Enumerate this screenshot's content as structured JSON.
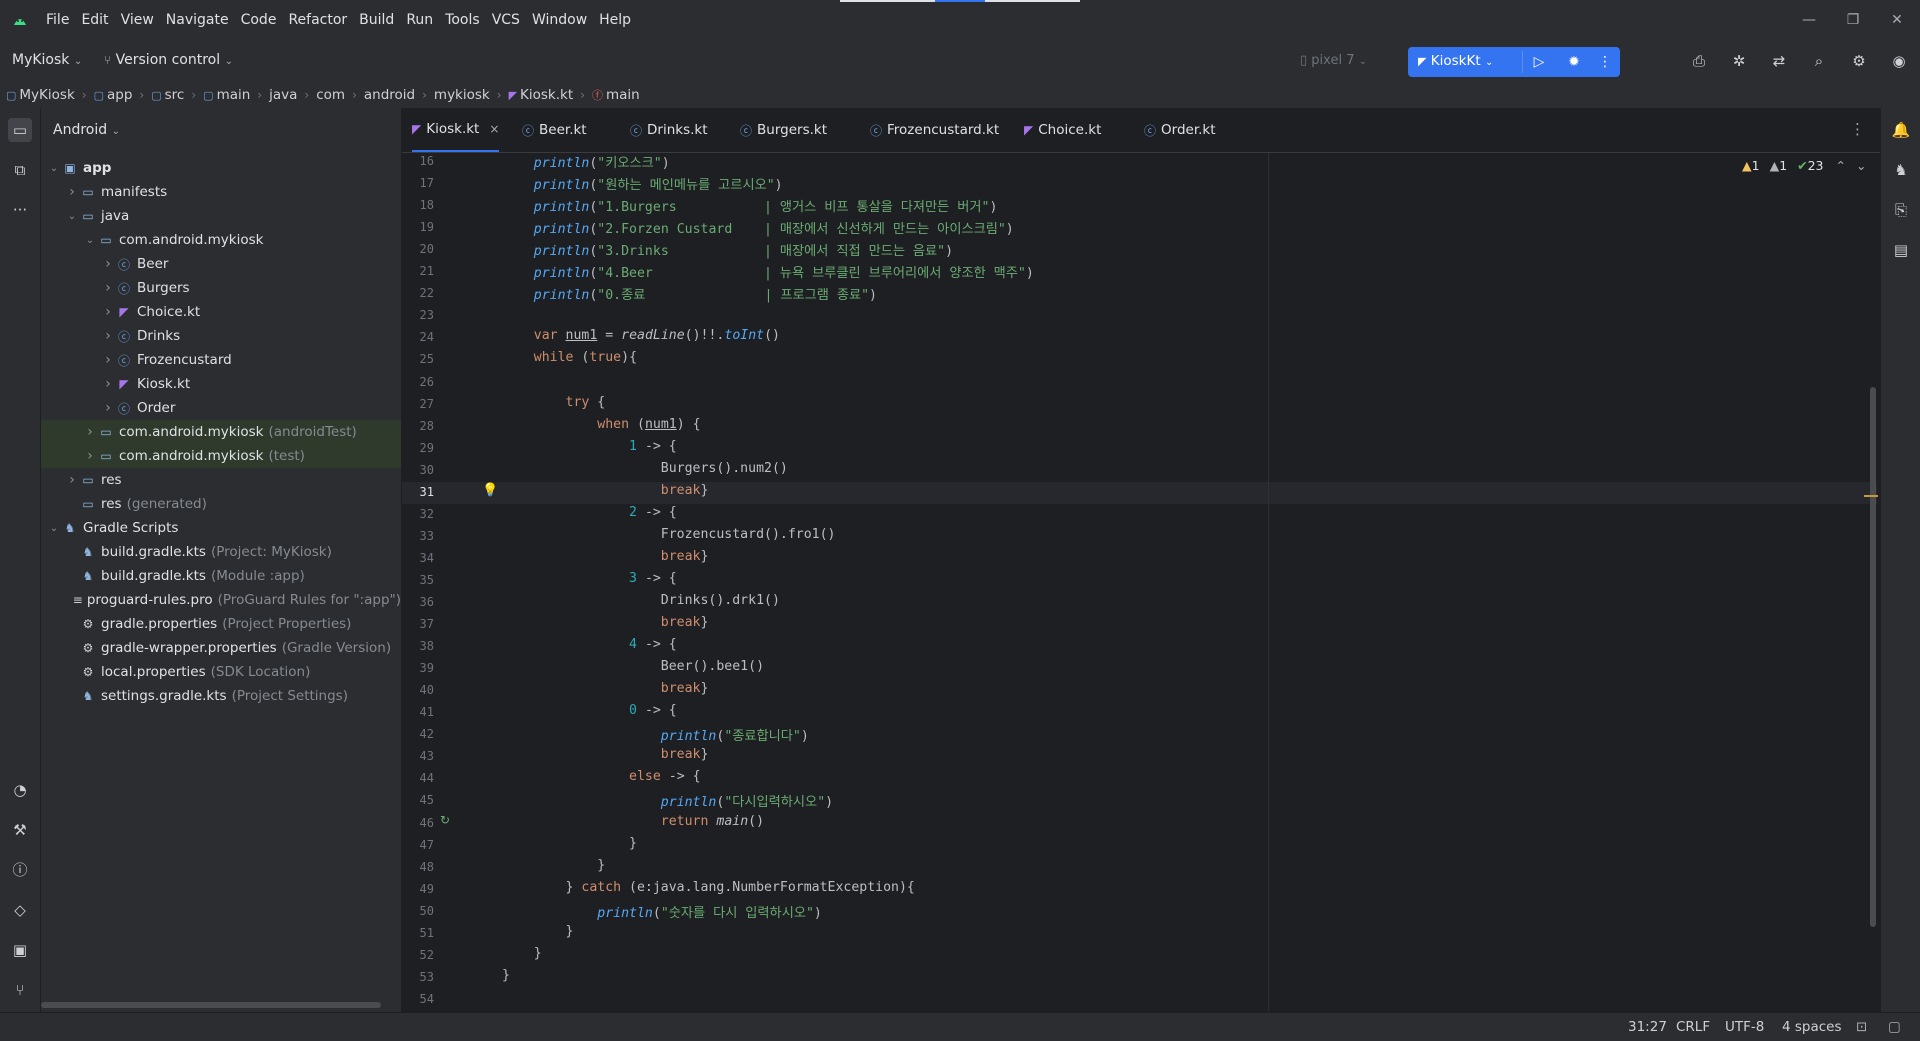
{
  "menu": [
    "File",
    "Edit",
    "View",
    "Navigate",
    "Code",
    "Refactor",
    "Build",
    "Run",
    "Tools",
    "VCS",
    "Window",
    "Help"
  ],
  "toolbar": {
    "project": "MyKiosk",
    "vcs": "Version control",
    "device": "pixel 7",
    "run_config": "KioskKt"
  },
  "breadcrumb": [
    "MyKiosk",
    "app",
    "src",
    "main",
    "java",
    "com",
    "android",
    "mykiosk",
    "Kiosk.kt",
    "main"
  ],
  "panel": {
    "title": "Android"
  },
  "tree": [
    {
      "label": "app",
      "hint": "",
      "icon": "folder-module",
      "depth": 0,
      "arrow": "open",
      "hl": false,
      "bold": true
    },
    {
      "label": "manifests",
      "hint": "",
      "icon": "folder",
      "depth": 1,
      "arrow": "closed",
      "hl": false
    },
    {
      "label": "java",
      "hint": "",
      "icon": "folder",
      "depth": 1,
      "arrow": "open",
      "hl": false
    },
    {
      "label": "com.android.mykiosk",
      "hint": "",
      "icon": "package",
      "depth": 2,
      "arrow": "open",
      "hl": false
    },
    {
      "label": "Beer",
      "hint": "",
      "icon": "class",
      "depth": 3,
      "arrow": "closed",
      "hl": false
    },
    {
      "label": "Burgers",
      "hint": "",
      "icon": "class",
      "depth": 3,
      "arrow": "closed",
      "hl": false
    },
    {
      "label": "Choice.kt",
      "hint": "",
      "icon": "kotlin",
      "depth": 3,
      "arrow": "closed",
      "hl": false
    },
    {
      "label": "Drinks",
      "hint": "",
      "icon": "class",
      "depth": 3,
      "arrow": "closed",
      "hl": false
    },
    {
      "label": "Frozencustard",
      "hint": "",
      "icon": "class",
      "depth": 3,
      "arrow": "closed",
      "hl": false
    },
    {
      "label": "Kiosk.kt",
      "hint": "",
      "icon": "kotlin",
      "depth": 3,
      "arrow": "closed",
      "hl": false
    },
    {
      "label": "Order",
      "hint": "",
      "icon": "class",
      "depth": 3,
      "arrow": "closed",
      "hl": false
    },
    {
      "label": "com.android.mykiosk",
      "hint": "(androidTest)",
      "icon": "package",
      "depth": 2,
      "arrow": "closed",
      "hl": true
    },
    {
      "label": "com.android.mykiosk",
      "hint": "(test)",
      "icon": "package",
      "depth": 2,
      "arrow": "closed",
      "hl": true
    },
    {
      "label": "res",
      "hint": "",
      "icon": "folder",
      "depth": 1,
      "arrow": "closed",
      "hl": false
    },
    {
      "label": "res",
      "hint": "(generated)",
      "icon": "folder",
      "depth": 1,
      "arrow": "none",
      "hl": false
    },
    {
      "label": "Gradle Scripts",
      "hint": "",
      "icon": "gradle",
      "depth": 0,
      "arrow": "open",
      "hl": false
    },
    {
      "label": "build.gradle.kts",
      "hint": "(Project: MyKiosk)",
      "icon": "gradle-file",
      "depth": 1,
      "arrow": "none",
      "hl": false
    },
    {
      "label": "build.gradle.kts",
      "hint": "(Module :app)",
      "icon": "gradle-file",
      "depth": 1,
      "arrow": "none",
      "hl": false
    },
    {
      "label": "proguard-rules.pro",
      "hint": "(ProGuard Rules for \":app\")",
      "icon": "text-file",
      "depth": 1,
      "arrow": "none",
      "hl": false
    },
    {
      "label": "gradle.properties",
      "hint": "(Project Properties)",
      "icon": "settings-file",
      "depth": 1,
      "arrow": "none",
      "hl": false
    },
    {
      "label": "gradle-wrapper.properties",
      "hint": "(Gradle Version)",
      "icon": "settings-file",
      "depth": 1,
      "arrow": "none",
      "hl": false
    },
    {
      "label": "local.properties",
      "hint": "(SDK Location)",
      "icon": "settings-file",
      "depth": 1,
      "arrow": "none",
      "hl": false
    },
    {
      "label": "settings.gradle.kts",
      "hint": "(Project Settings)",
      "icon": "gradle-file",
      "depth": 1,
      "arrow": "none",
      "hl": false
    }
  ],
  "tabs": [
    {
      "label": "Kiosk.kt",
      "active": true,
      "icon": "kotlin"
    },
    {
      "label": "Beer.kt",
      "active": false,
      "icon": "class"
    },
    {
      "label": "Drinks.kt",
      "active": false,
      "icon": "class"
    },
    {
      "label": "Burgers.kt",
      "active": false,
      "icon": "class"
    },
    {
      "label": "Frozencustard.kt",
      "active": false,
      "icon": "class"
    },
    {
      "label": "Choice.kt",
      "active": false,
      "icon": "kotlin"
    },
    {
      "label": "Order.kt",
      "active": false,
      "icon": "class"
    }
  ],
  "inspections": {
    "warnings": "1",
    "weak": "1",
    "ok": "23"
  },
  "code": {
    "first_line": 16,
    "current_line": 31,
    "lines": [
      "    println(\"키오스크\")",
      "    println(\"원하는 메인메뉴를 고르시오\")",
      "    println(\"1.Burgers           | 앵거스 비프 통살을 다져만든 버거\")",
      "    println(\"2.Forzen Custard    | 매장에서 신선하게 만드는 아이스크림\")",
      "    println(\"3.Drinks            | 매장에서 직접 만드는 음료\")",
      "    println(\"4.Beer              | 뉴욕 브루클린 브루어리에서 양조한 맥주\")",
      "    println(\"0.종료               | 프로그램 종료\")",
      "",
      "    var num1 = readLine()!!.toInt()",
      "    while (true){",
      "",
      "        try {",
      "            when (num1) {",
      "                1 -> {",
      "                    Burgers().num2()",
      "                    break}",
      "                2 -> {",
      "                    Frozencustard().fro1()",
      "                    break}",
      "                3 -> {",
      "                    Drinks().drk1()",
      "                    break}",
      "                4 -> {",
      "                    Beer().bee1()",
      "                    break}",
      "                0 -> {",
      "                    println(\"종료합니다\")",
      "                    break}",
      "                else -> {",
      "                    println(\"다시입력하시오\")",
      "                    return main()",
      "                }",
      "            }",
      "        } catch (e:java.lang.NumberFormatException){",
      "            println(\"숫자를 다시 입력하시오\")",
      "        }",
      "    }",
      "}",
      ""
    ]
  },
  "status": {
    "position": "31:27",
    "line_sep": "CRLF",
    "encoding": "UTF-8",
    "indent": "4 spaces"
  }
}
